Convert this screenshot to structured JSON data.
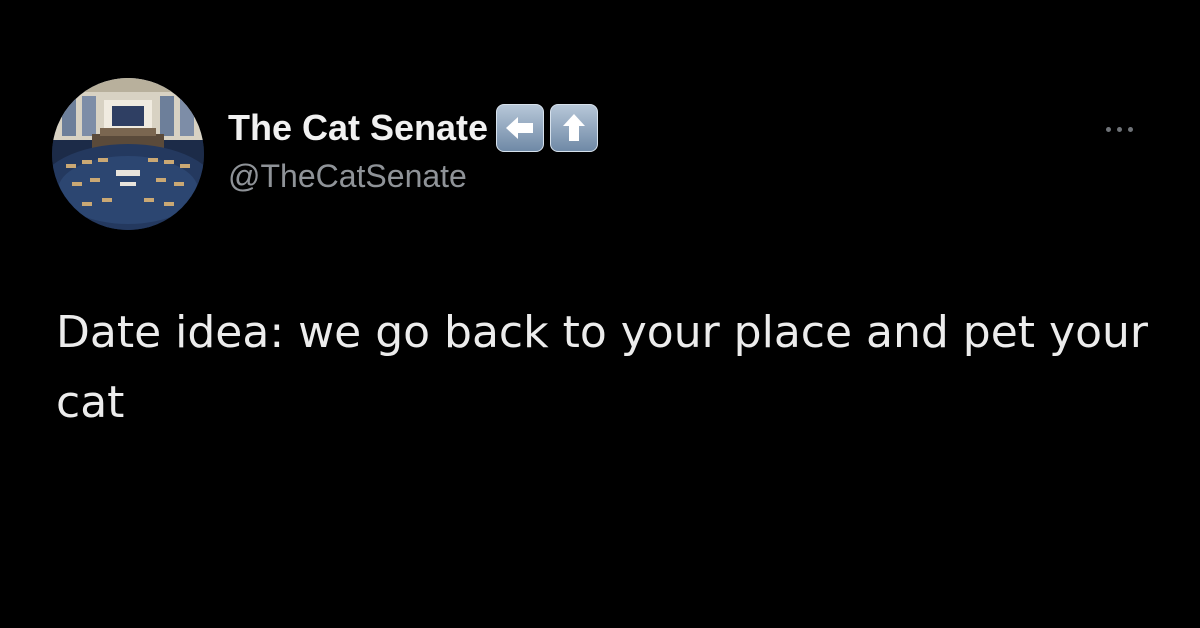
{
  "tweet": {
    "author": {
      "display_name": "The Cat Senate",
      "handle": "@TheCatSenate",
      "badges": [
        "left-arrow-emoji-icon",
        "up-arrow-emoji-icon"
      ],
      "avatar_icon": "senate-chamber-avatar"
    },
    "more_menu_icon": "more-horizontal-icon",
    "text": "Date idea: we go back to your place and pet your cat"
  },
  "colors": {
    "background": "#000000",
    "name": "#f1f1f1",
    "handle": "#8f9398",
    "text": "#ececec",
    "emoji_badge": "#8ea3bb"
  }
}
